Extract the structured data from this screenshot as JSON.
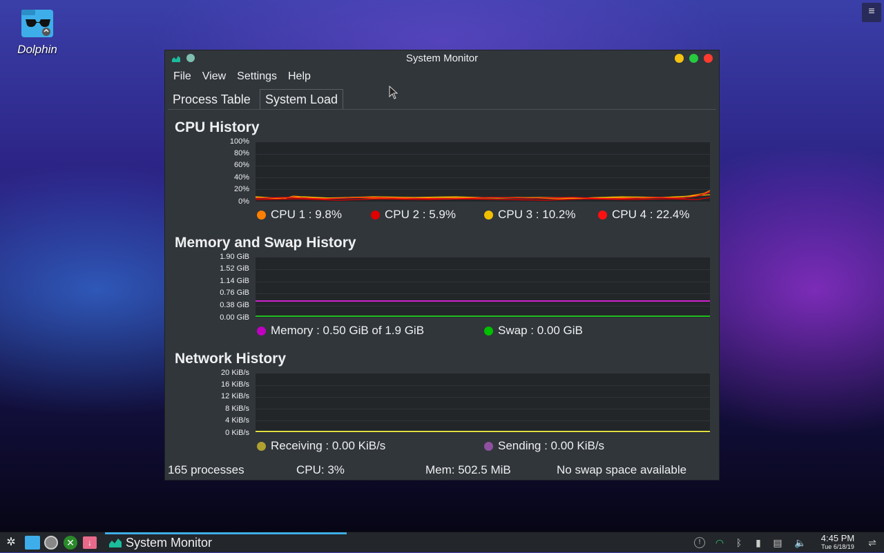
{
  "desktop": {
    "icon_label": "Dolphin",
    "menu_icon": "hamburger-menu-icon"
  },
  "window": {
    "title": "System Monitor",
    "menu": [
      "File",
      "View",
      "Settings",
      "Help"
    ],
    "tabs": [
      "Process Table",
      "System Load"
    ],
    "active_tab": "System Load",
    "colors": {
      "minimize": "#f5c211",
      "maximize": "#27c93f",
      "close": "#ff3b30"
    }
  },
  "cpu": {
    "title": "CPU History",
    "yticks": [
      "100%",
      "80%",
      "60%",
      "40%",
      "20%",
      "0%"
    ],
    "legend": [
      {
        "label": "CPU 1 : 9.8%",
        "color": "#ff8000"
      },
      {
        "label": "CPU 2 : 5.9%",
        "color": "#e00000"
      },
      {
        "label": "CPU 3 : 10.2%",
        "color": "#f0c000"
      },
      {
        "label": "CPU 4 : 22.4%",
        "color": "#ff1010"
      }
    ]
  },
  "memory": {
    "title": "Memory and Swap History",
    "yticks": [
      "1.90 GiB",
      "1.52 GiB",
      "1.14 GiB",
      "0.76 GiB",
      "0.38 GiB",
      "0.00 GiB"
    ],
    "legend": [
      {
        "label": "Memory : 0.50 GiB of 1.9 GiB",
        "color": "#c000c0"
      },
      {
        "label": "Swap : 0.00 GiB",
        "color": "#00c000"
      }
    ]
  },
  "network": {
    "title": "Network History",
    "yticks": [
      "20 KiB/s",
      "16 KiB/s",
      "12 KiB/s",
      "8 KiB/s",
      "4 KiB/s",
      "0 KiB/s"
    ],
    "legend": [
      {
        "label": "Receiving : 0.00 KiB/s",
        "color": "#b0a030"
      },
      {
        "label": "Sending : 0.00 KiB/s",
        "color": "#9050a0"
      }
    ]
  },
  "statusbar": {
    "processes": "165 processes",
    "cpu": "CPU: 3%",
    "mem": "Mem: 502.5 MiB",
    "swap": "No swap space available"
  },
  "taskbar": {
    "active_task": "System Monitor",
    "time": "4:45 PM",
    "date": "Tue 6/18/19"
  }
}
